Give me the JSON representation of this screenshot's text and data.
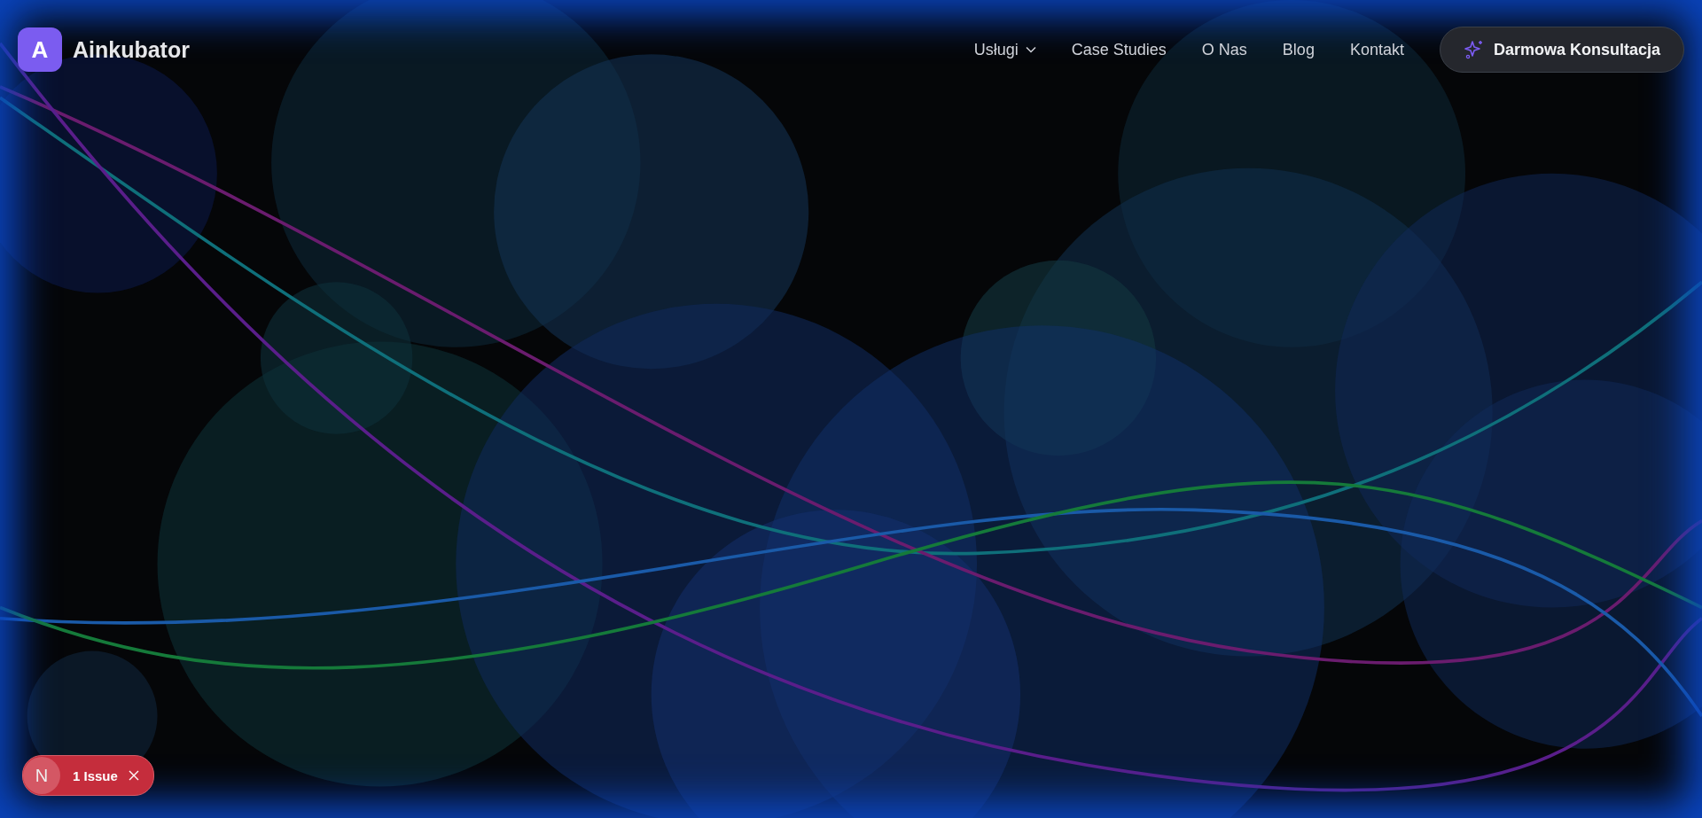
{
  "logo": {
    "letter": "A",
    "name": "Ainkubator"
  },
  "nav": [
    {
      "label": "Usługi",
      "has_dropdown": true
    },
    {
      "label": "Case Studies",
      "has_dropdown": false
    },
    {
      "label": "O Nas",
      "has_dropdown": false
    },
    {
      "label": "Blog",
      "has_dropdown": false
    },
    {
      "label": "Kontakt",
      "has_dropdown": false
    }
  ],
  "cta": {
    "label": "Darmowa Konsultacja"
  },
  "issue_badge": {
    "letter": "N",
    "label": "1 Issue"
  }
}
